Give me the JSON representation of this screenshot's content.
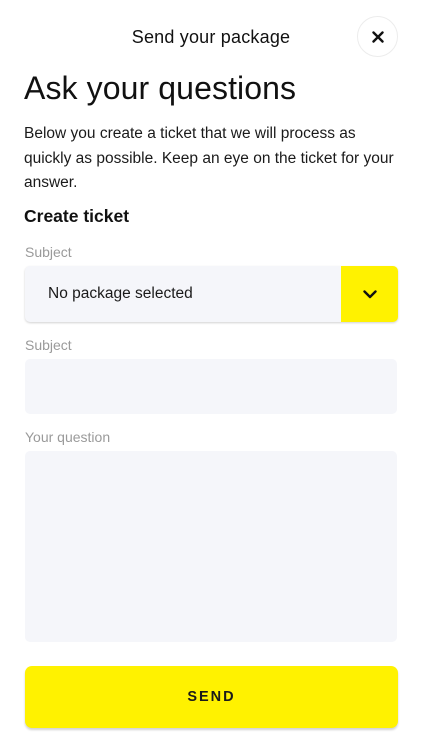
{
  "header": {
    "title": "Send your package",
    "close_icon": "close-icon"
  },
  "page": {
    "title": "Ask your questions",
    "intro": "Below you create a ticket that we will process as quickly as possible. Keep an eye on the ticket for your answer."
  },
  "form": {
    "section_title": "Create ticket",
    "package_select": {
      "label": "Subject",
      "value": "No package selected",
      "icon": "chevron-down-icon"
    },
    "subject": {
      "label": "Subject",
      "value": "",
      "placeholder": ""
    },
    "question": {
      "label": "Your question",
      "value": "",
      "placeholder": ""
    },
    "submit_label": "SEND"
  },
  "colors": {
    "accent": "#fff200",
    "field_bg": "#f5f6fa",
    "label": "#9a9a9a",
    "text": "#111111"
  }
}
